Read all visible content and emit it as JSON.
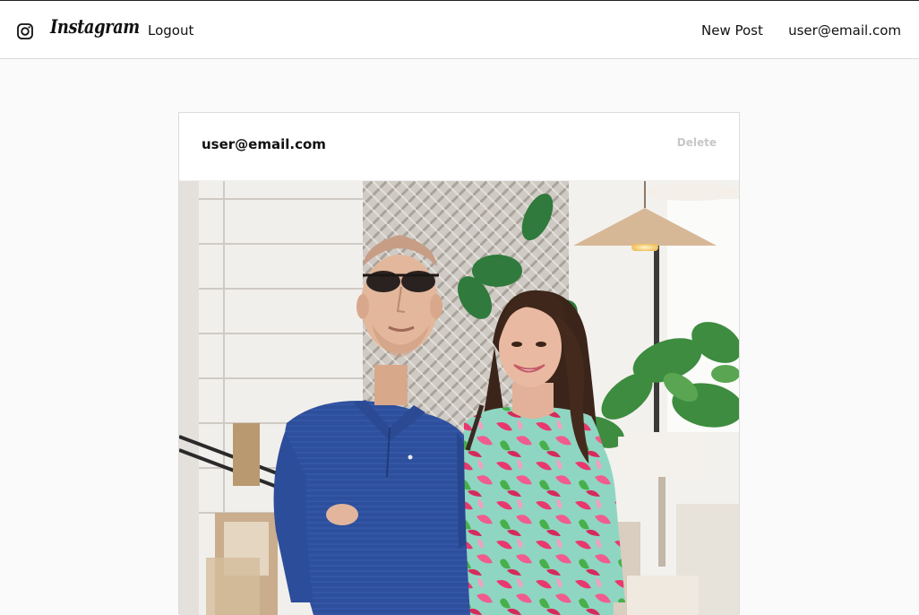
{
  "navbar": {
    "brand": "Instagram",
    "logout_label": "Logout",
    "new_post_label": "New Post",
    "user_email": "user@email.com"
  },
  "post": {
    "author": "user@email.com",
    "delete_label": "Delete"
  },
  "colors": {
    "page_background": "#fafafa",
    "border": "#dbdbdb",
    "delete_text": "#c7c7c7"
  },
  "icons": [
    "instagram-camera-icon"
  ]
}
